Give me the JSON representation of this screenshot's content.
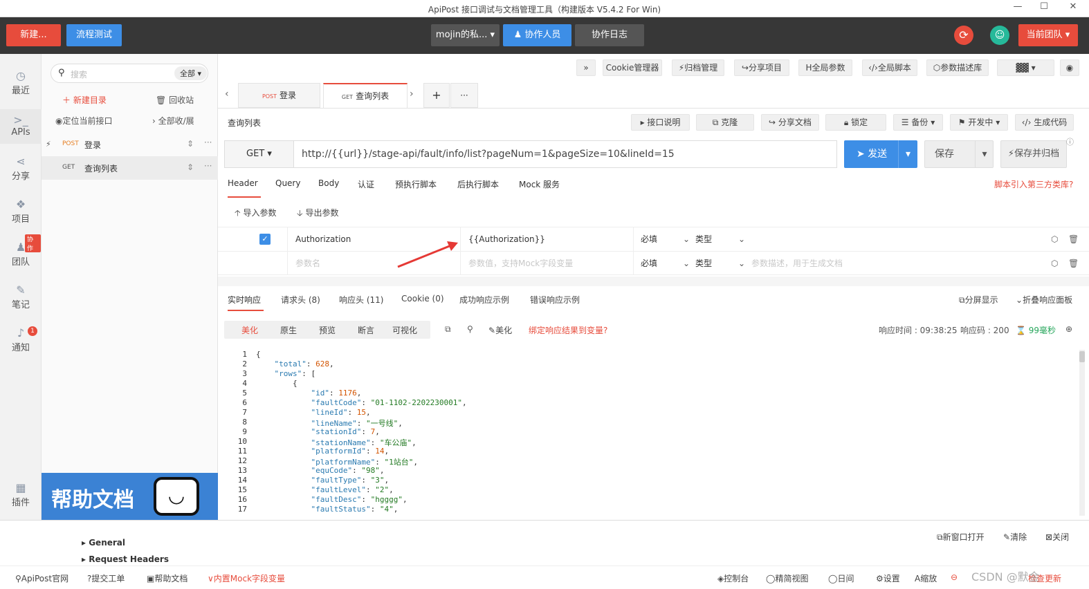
{
  "app": {
    "title": "ApiPost 接口调试与文档管理工具（构建版本 V5.4.2 For Win)",
    "min": "—",
    "max": "☐",
    "close": "✕"
  },
  "topbar": {
    "new_label": "新建...",
    "flow_label": "流程测试",
    "workspace": "mojin的私...",
    "collab_label": "协作人员",
    "log_label": "协作日志",
    "team_label": "当前团队"
  },
  "nav": [
    {
      "icon": "◷",
      "label": "最近"
    },
    {
      "icon": ">_",
      "label": "APIs"
    },
    {
      "icon": "⋖",
      "label": "分享"
    },
    {
      "icon": "❖",
      "label": "项目"
    },
    {
      "icon": "♟",
      "label": "团队",
      "badge": "协作"
    },
    {
      "icon": "✎",
      "label": "笔记"
    },
    {
      "icon": "♪",
      "label": "通知",
      "badge": "1"
    },
    {
      "icon": "▦",
      "label": "插件"
    }
  ],
  "sidebar": {
    "search_placeholder": "搜索",
    "filter": "全部",
    "new_dir": "新建目录",
    "recycle": "回收站",
    "locate": "定位当前接口",
    "expand": "全部收/展",
    "items": [
      {
        "method": "POST",
        "name": "登录"
      },
      {
        "method": "GET",
        "name": "查询列表"
      }
    ],
    "banner": "帮助文档"
  },
  "toolbar": {
    "expand": "»",
    "cookie": "Cookie管理器",
    "archive": "归档管理",
    "share_project": "分享项目",
    "global_params": "全局参数",
    "global_script": "全局脚本",
    "param_lib": "参数描述库"
  },
  "tabs": [
    {
      "method": "POST",
      "name": "登录"
    },
    {
      "method": "GET",
      "name": "查询列表"
    }
  ],
  "tab_add": "+",
  "tab_more": "···",
  "request": {
    "name": "查询列表",
    "doc": "接口说明",
    "clone": "克隆",
    "share_doc": "分享文档",
    "lock": "锁定",
    "backup": "备份",
    "dev_status": "开发中",
    "gen_code": "生成代码",
    "method": "GET",
    "url": "http://{{url}}/stage-api/fault/info/list?pageNum=1&pageSize=10&lineId=15",
    "send": "发送",
    "save": "保存",
    "save_archive": "保存并归档"
  },
  "param_tabs": [
    "Header",
    "Query",
    "Body",
    "认证",
    "预执行脚本",
    "后执行脚本",
    "Mock 服务"
  ],
  "third_party": "脚本引入第三方类库?",
  "import_label": "导入参数",
  "export_label": "导出参数",
  "params": [
    {
      "name": "Authorization",
      "value": "{{Authorization}}",
      "required": "必填",
      "type": "类型",
      "desc": ""
    },
    {
      "name": "参数名",
      "value": "参数值，支持Mock字段变量",
      "required": "必填",
      "type": "类型",
      "desc": "参数描述，用于生成文档"
    }
  ],
  "resp_tabs": [
    "实时响应",
    "请求头 (8)",
    "响应头 (11)",
    "Cookie (0)",
    "成功响应示例",
    "错误响应示例"
  ],
  "split": "分屏显示",
  "fold": "折叠响应面板",
  "view_tabs": [
    "美化",
    "原生",
    "预览",
    "断言",
    "可视化"
  ],
  "beautify": "美化",
  "bind_var": "绑定响应结果到变量?",
  "resp_meta": {
    "time_label": "响应时间 : 09:38:25",
    "code_label": "响应码 : 200",
    "duration": "99毫秒"
  },
  "code_lines": [
    [
      "1",
      "{"
    ],
    [
      "2",
      "    \"total\": 628,"
    ],
    [
      "3",
      "    \"rows\": ["
    ],
    [
      "4",
      "        {"
    ],
    [
      "5",
      "            \"id\": 1176,"
    ],
    [
      "6",
      "            \"faultCode\": \"01-1102-2202230001\","
    ],
    [
      "7",
      "            \"lineId\": 15,"
    ],
    [
      "8",
      "            \"lineName\": \"一号线\","
    ],
    [
      "9",
      "            \"stationId\": 7,"
    ],
    [
      "10",
      "            \"stationName\": \"车公庙\","
    ],
    [
      "11",
      "            \"platformId\": 14,"
    ],
    [
      "12",
      "            \"platformName\": \"1站台\","
    ],
    [
      "13",
      "            \"equCode\": \"98\","
    ],
    [
      "14",
      "            \"faultType\": \"3\","
    ],
    [
      "15",
      "            \"faultLevel\": \"2\","
    ],
    [
      "16",
      "            \"faultDesc\": \"hgggg\","
    ],
    [
      "17",
      "            \"faultStatus\": \"4\","
    ]
  ],
  "bottom": {
    "general": "General",
    "req_headers": "Request Headers",
    "new_window": "新窗口打开",
    "clear": "清除",
    "close": "关闭"
  },
  "status": {
    "site": "ApiPost官网",
    "ticket": "提交工单",
    "help": "帮助文档",
    "mock": "内置Mock字段变量",
    "console": "控制台",
    "simple": "精简视图",
    "day": "日间",
    "settings": "设置",
    "zoom": "缩放",
    "update": "检查更新",
    "watermark": "CSDN @默金"
  }
}
